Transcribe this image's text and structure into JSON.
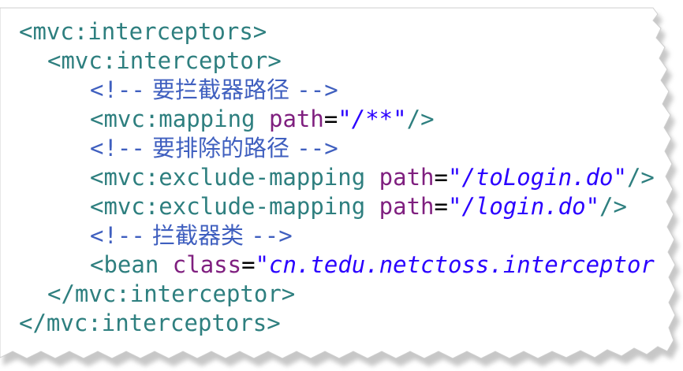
{
  "code": {
    "line1": {
      "tag": "<mvc:interceptors>"
    },
    "line2": {
      "tag": "<mvc:interceptor>"
    },
    "line3": {
      "open": "<!--",
      "text": " 要拦截器路径 ",
      "close": "-->"
    },
    "line4": {
      "tag": "<mvc:mapping",
      "attr": "path",
      "eq": "=",
      "value": "\"/**\"",
      "close": "/>"
    },
    "line5": {
      "open": "<!--",
      "text": " 要排除的路径 ",
      "close": "-->"
    },
    "line6": {
      "tag": "<mvc:exclude-mapping",
      "attr": "path",
      "eq": "=",
      "value": "\"/toLogin.do\"",
      "close": "/>"
    },
    "line7": {
      "tag": "<mvc:exclude-mapping",
      "attr": "path",
      "eq": "=",
      "value": "\"/login.do\"",
      "close": "/>"
    },
    "line8": {
      "open": "<!--",
      "text": " 拦截器类 ",
      "close": "-->"
    },
    "line9": {
      "tag": "<bean",
      "attr": "class",
      "eq": "=",
      "value": "\"cn.tedu.netctoss.interceptor"
    },
    "line10": {
      "tag": "</mvc:interceptor>"
    },
    "line11": {
      "tag": "</mvc:interceptors>"
    }
  },
  "colors": {
    "tag": "#2e7f7f",
    "attribute": "#7f1f7f",
    "value": "#2a00ff",
    "comment": "#3f5fbf"
  }
}
